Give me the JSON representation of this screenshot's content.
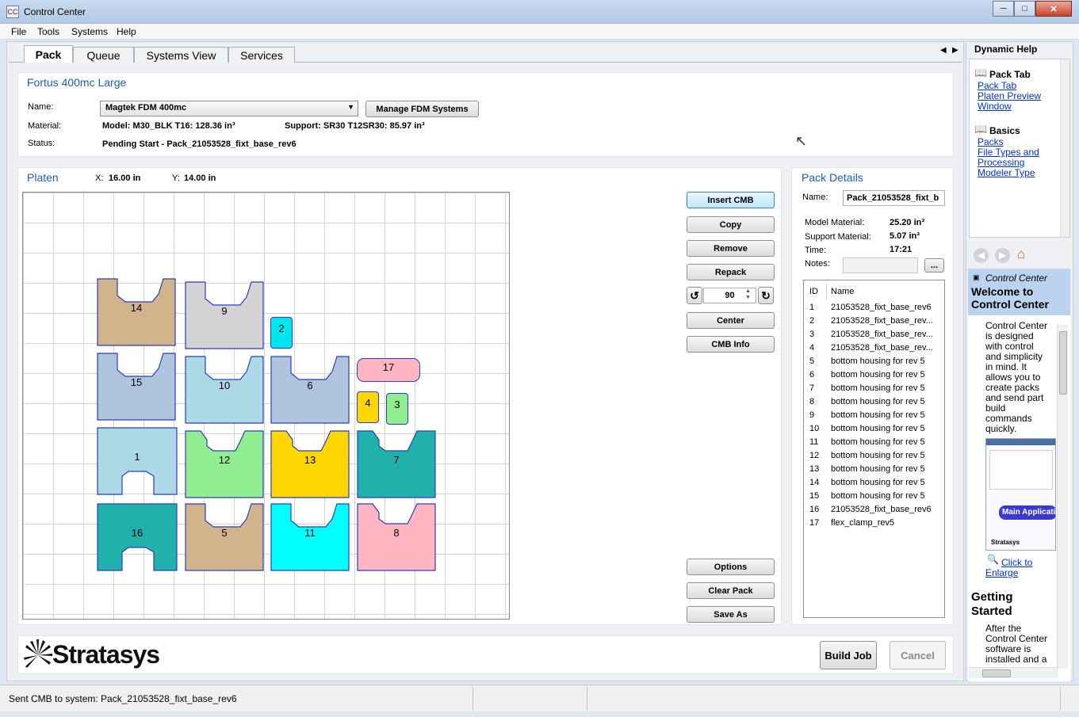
{
  "window": {
    "title": "Control Center"
  },
  "menu": [
    "File",
    "Tools",
    "Systems",
    "Help"
  ],
  "tabs": [
    "Pack",
    "Queue",
    "Systems View",
    "Services"
  ],
  "system": {
    "title": "Fortus 400mc Large",
    "name_label": "Name:",
    "name_value": "Magtek FDM 400mc",
    "manage_button": "Manage FDM Systems",
    "material_label": "Material:",
    "model_material": "Model: M30_BLK T16: 128.36 in³",
    "support_material": "Support: SR30 T12SR30: 85.97 in³",
    "status_label": "Status:",
    "status_value": "Pending Start - Pack_21053528_fixt_base_rev6"
  },
  "platen": {
    "title": "Platen",
    "x_label": "X:",
    "x_value": "16.00 in",
    "y_label": "Y:",
    "y_value": "14.00 in",
    "parts": [
      {
        "id": "14",
        "color": "#d2b48c"
      },
      {
        "id": "9",
        "color": "#d3d3d3"
      },
      {
        "id": "2",
        "color": "#00e5ee"
      },
      {
        "id": "15",
        "color": "#b0c4de"
      },
      {
        "id": "10",
        "color": "#add8e6"
      },
      {
        "id": "6",
        "color": "#b0c4de"
      },
      {
        "id": "17",
        "color": "#ffb6c1"
      },
      {
        "id": "4",
        "color": "#ffd700"
      },
      {
        "id": "3",
        "color": "#90ee90"
      },
      {
        "id": "1",
        "color": "#add8e6"
      },
      {
        "id": "12",
        "color": "#90ee90"
      },
      {
        "id": "13",
        "color": "#ffd700"
      },
      {
        "id": "7",
        "color": "#20b2aa"
      },
      {
        "id": "16",
        "color": "#20b2aa"
      },
      {
        "id": "5",
        "color": "#d2b48c"
      },
      {
        "id": "11",
        "color": "#00ffff"
      },
      {
        "id": "8",
        "color": "#ffb6c1"
      }
    ]
  },
  "actions": {
    "insert_cmb": "Insert CMB",
    "copy": "Copy",
    "remove": "Remove",
    "repack": "Repack",
    "rotate_value": "90",
    "center": "Center",
    "cmb_info": "CMB Info",
    "options": "Options",
    "clear_pack": "Clear Pack",
    "save_as": "Save As"
  },
  "pack_details": {
    "title": "Pack Details",
    "name_label": "Name:",
    "name_value": "Pack_21053528_fixt_b",
    "model_label": "Model Material:",
    "model_value": "25.20 in³",
    "support_label": "Support Material:",
    "support_value": "5.07 in³",
    "time_label": "Time:",
    "time_value": "17:21",
    "notes_label": "Notes:",
    "notes_button": "...",
    "col_id": "ID",
    "col_name": "Name",
    "rows": [
      {
        "id": "1",
        "name": "21053528_fixt_base_rev6"
      },
      {
        "id": "2",
        "name": "21053528_fixt_base_rev..."
      },
      {
        "id": "3",
        "name": "21053528_fixt_base_rev..."
      },
      {
        "id": "4",
        "name": "21053528_fixt_base_rev..."
      },
      {
        "id": "5",
        "name": "bottom housing for rev 5"
      },
      {
        "id": "6",
        "name": "bottom housing for rev 5"
      },
      {
        "id": "7",
        "name": "bottom housing for rev 5"
      },
      {
        "id": "8",
        "name": "bottom housing for rev 5"
      },
      {
        "id": "9",
        "name": "bottom housing for rev 5"
      },
      {
        "id": "10",
        "name": "bottom housing for rev 5"
      },
      {
        "id": "11",
        "name": "bottom housing for rev 5"
      },
      {
        "id": "12",
        "name": "bottom housing for rev 5"
      },
      {
        "id": "13",
        "name": "bottom housing for rev 5"
      },
      {
        "id": "14",
        "name": "bottom housing for rev 5"
      },
      {
        "id": "15",
        "name": "bottom housing for rev 5"
      },
      {
        "id": "16",
        "name": "21053528_fixt_base_rev6"
      },
      {
        "id": "17",
        "name": "flex_clamp_rev5"
      }
    ]
  },
  "footer": {
    "brand": "Stratasys",
    "build_job": "Build Job",
    "cancel": "Cancel"
  },
  "help": {
    "title": "Dynamic Help",
    "section1": "Pack Tab",
    "links1": [
      "Pack Tab",
      "Platen Preview",
      "Window"
    ],
    "section2": "Basics",
    "links2": [
      "Packs",
      "File Types and",
      "Processing",
      "Modeler Type"
    ],
    "crumb": "Control Center",
    "welcome1": "Welcome to",
    "welcome2": "Control Center",
    "body": [
      "Control Center",
      "is designed",
      "with control",
      "and simplicity",
      "in mind. It",
      "allows you to",
      "create packs",
      "and send part",
      "build",
      "commands",
      "quickly."
    ],
    "thumb_caption": "Main Applicati",
    "thumb_brand": "Stratasys",
    "enlarge": [
      "Click to",
      "Enlarge"
    ],
    "getting1": "Getting",
    "getting2": "Started",
    "body2": [
      "After the",
      "Control Center",
      "software is",
      "installed and a"
    ]
  },
  "status": {
    "message": "Sent CMB to system: Pack_21053528_fixt_base_rev6"
  }
}
